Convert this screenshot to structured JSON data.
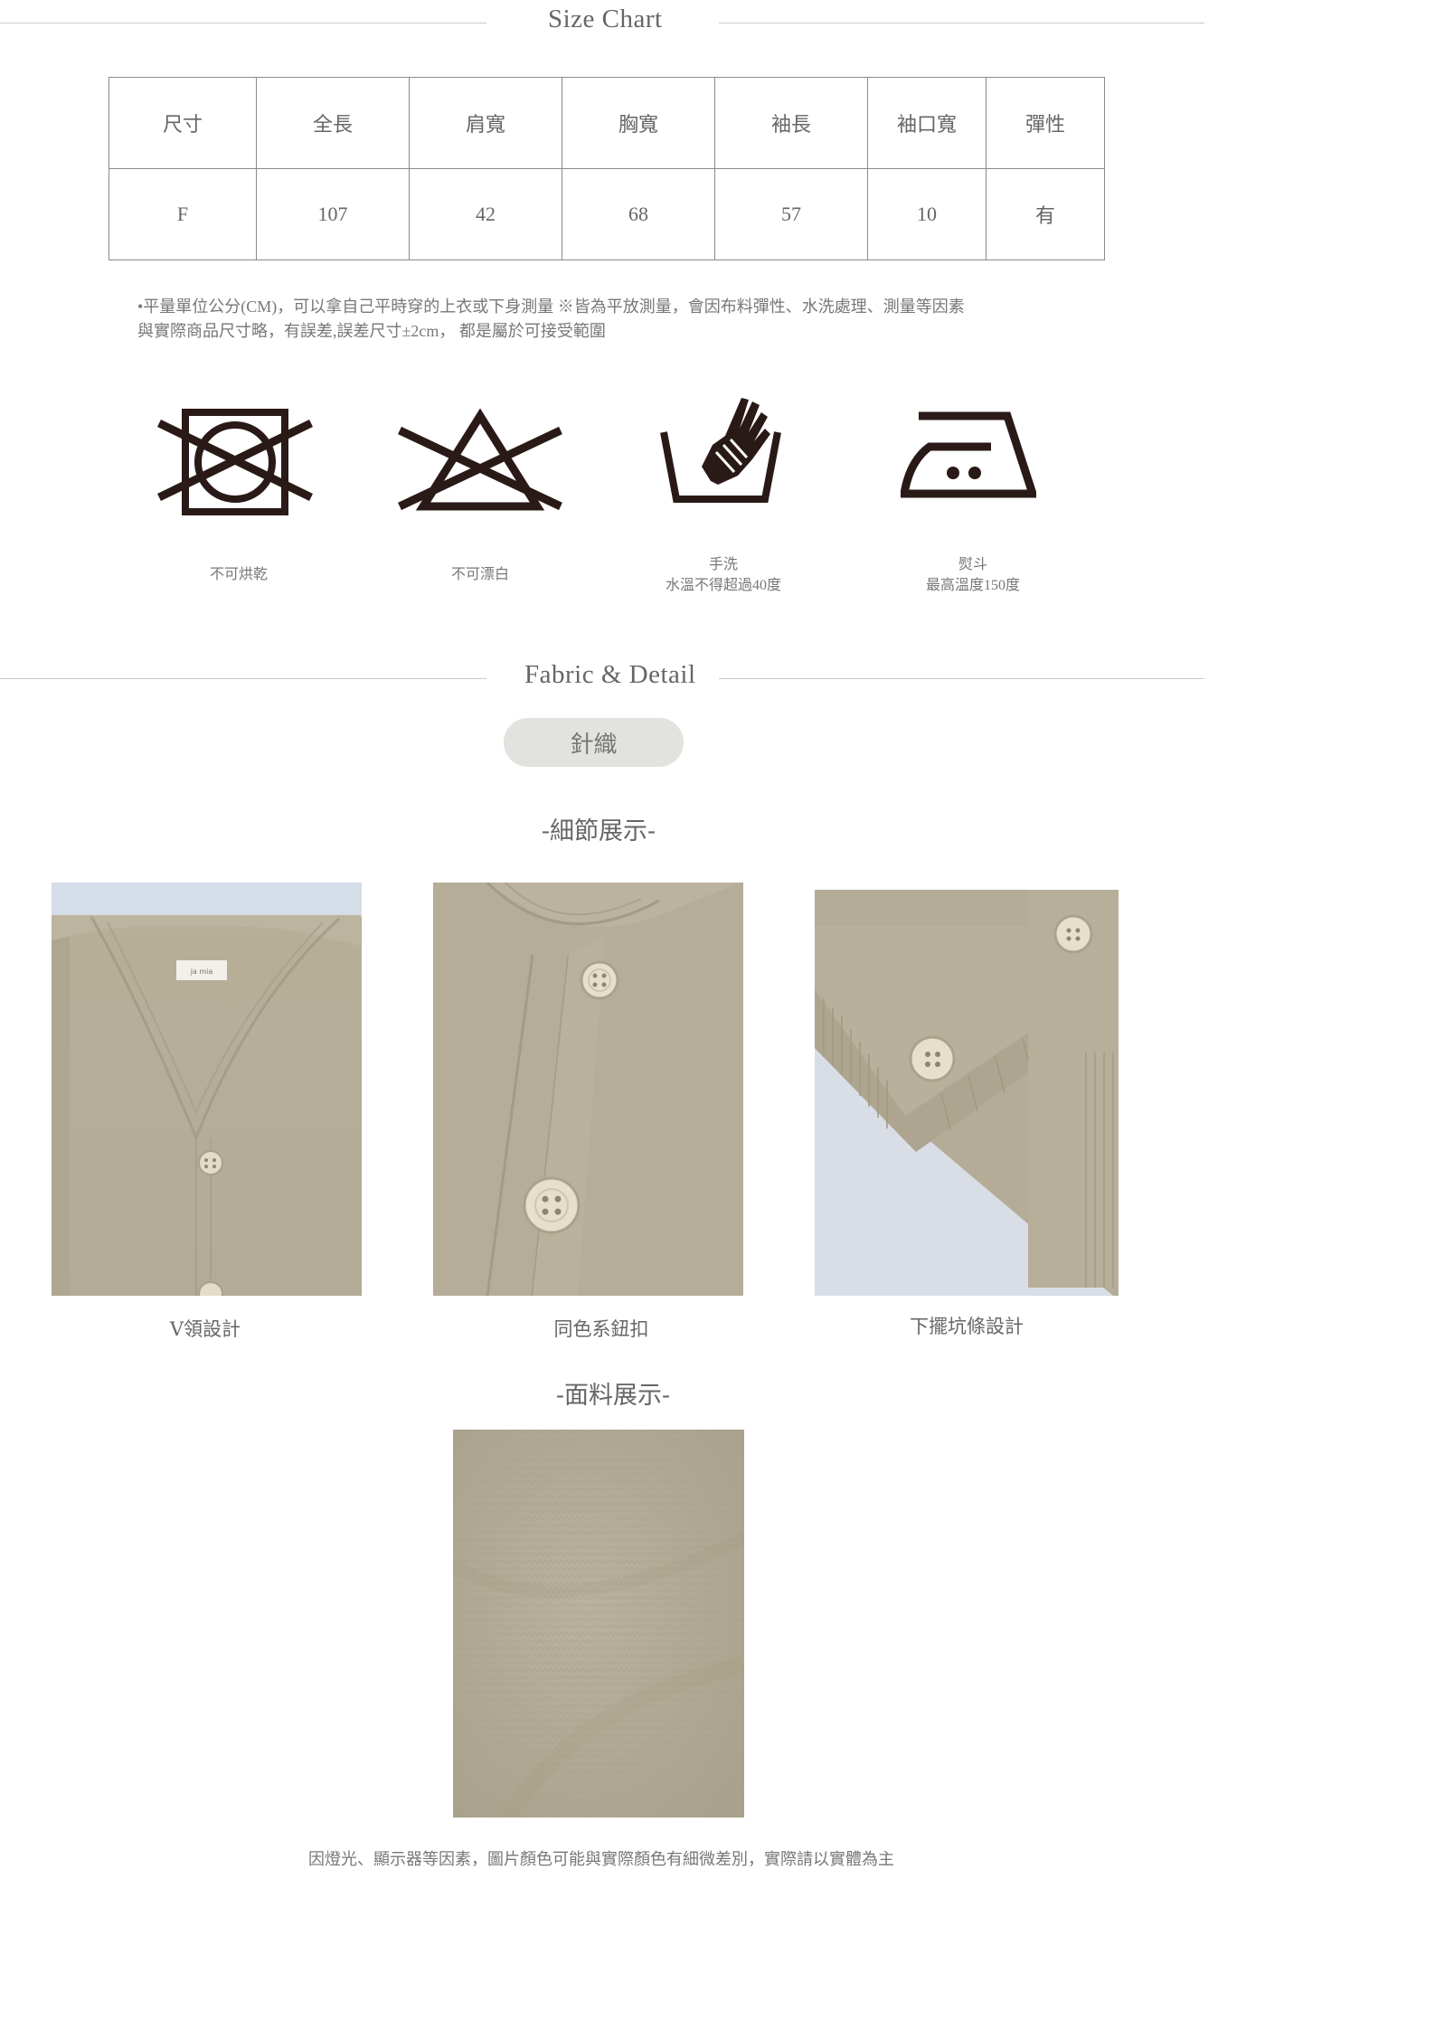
{
  "size_chart": {
    "title": "Size Chart",
    "headers": [
      "尺寸",
      "全長",
      "肩寬",
      "胸寬",
      "袖長",
      "袖口寬",
      "彈性"
    ],
    "rows": [
      [
        "F",
        "107",
        "42",
        "68",
        "57",
        "10",
        "有"
      ]
    ]
  },
  "note": {
    "line1": "•平量單位公分(CM)，可以拿自己平時穿的上衣或下身測量 ※皆為平放測量，會因布料彈性、水洗處理、測量等因素",
    "line2": "與實際商品尺寸略，有誤差,誤差尺寸±2cm， 都是屬於可接受範圍"
  },
  "care": [
    {
      "icon": "no-tumble-dry-icon",
      "label": "不可烘乾",
      "sub": ""
    },
    {
      "icon": "no-bleach-icon",
      "label": "不可漂白",
      "sub": ""
    },
    {
      "icon": "hand-wash-icon",
      "label": "手洗",
      "sub": "水溫不得超過40度"
    },
    {
      "icon": "iron-icon",
      "label": "熨斗",
      "sub": "最高溫度150度"
    }
  ],
  "fabric": {
    "title": "Fabric & Detail",
    "material": "針織",
    "detail_title": "-細節展示-",
    "fabric_title": "-面料展示-"
  },
  "details": [
    {
      "caption": "V領設計"
    },
    {
      "caption": "同色系鈕扣"
    },
    {
      "caption": "下擺坑條設計"
    }
  ],
  "photo_tag": "ja mia",
  "colors": {
    "knit": "#b6ae9a",
    "ink": "#2a1a17"
  },
  "footer": "因燈光、顯示器等因素，圖片顏色可能與實際顏色有細微差別，實際請以實體為主"
}
